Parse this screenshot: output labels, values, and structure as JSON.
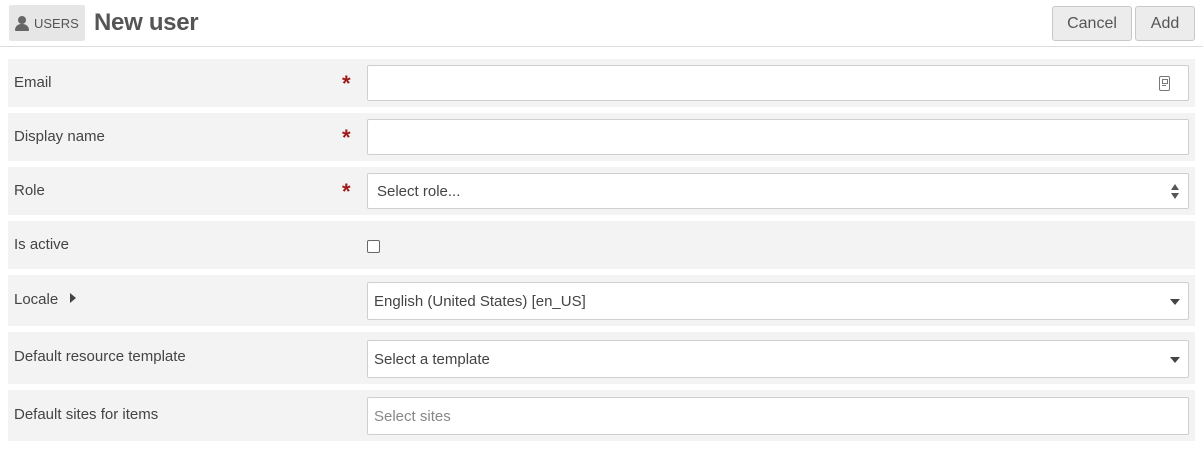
{
  "header": {
    "section_label": "USERS",
    "title": "New user",
    "cancel_label": "Cancel",
    "add_label": "Add"
  },
  "form": {
    "email": {
      "label": "Email",
      "required_mark": "*",
      "value": ""
    },
    "display_name": {
      "label": "Display name",
      "required_mark": "*",
      "value": ""
    },
    "role": {
      "label": "Role",
      "required_mark": "*",
      "selected": "Select role..."
    },
    "is_active": {
      "label": "Is active",
      "checked": false
    },
    "locale": {
      "label": "Locale",
      "selected": "English (United States) [en_US]"
    },
    "default_resource_template": {
      "label": "Default resource template",
      "selected": "Select a template"
    },
    "default_sites": {
      "label": "Default sites for items",
      "placeholder": "Select sites"
    }
  },
  "colors": {
    "required": "#9e1b1b",
    "row_background": "#f3f3f3",
    "button_background": "#ececec"
  },
  "icons": [
    "user-icon",
    "contact-card-icon",
    "select-updown-icon",
    "chevron-down-icon",
    "chevron-right-icon"
  ]
}
